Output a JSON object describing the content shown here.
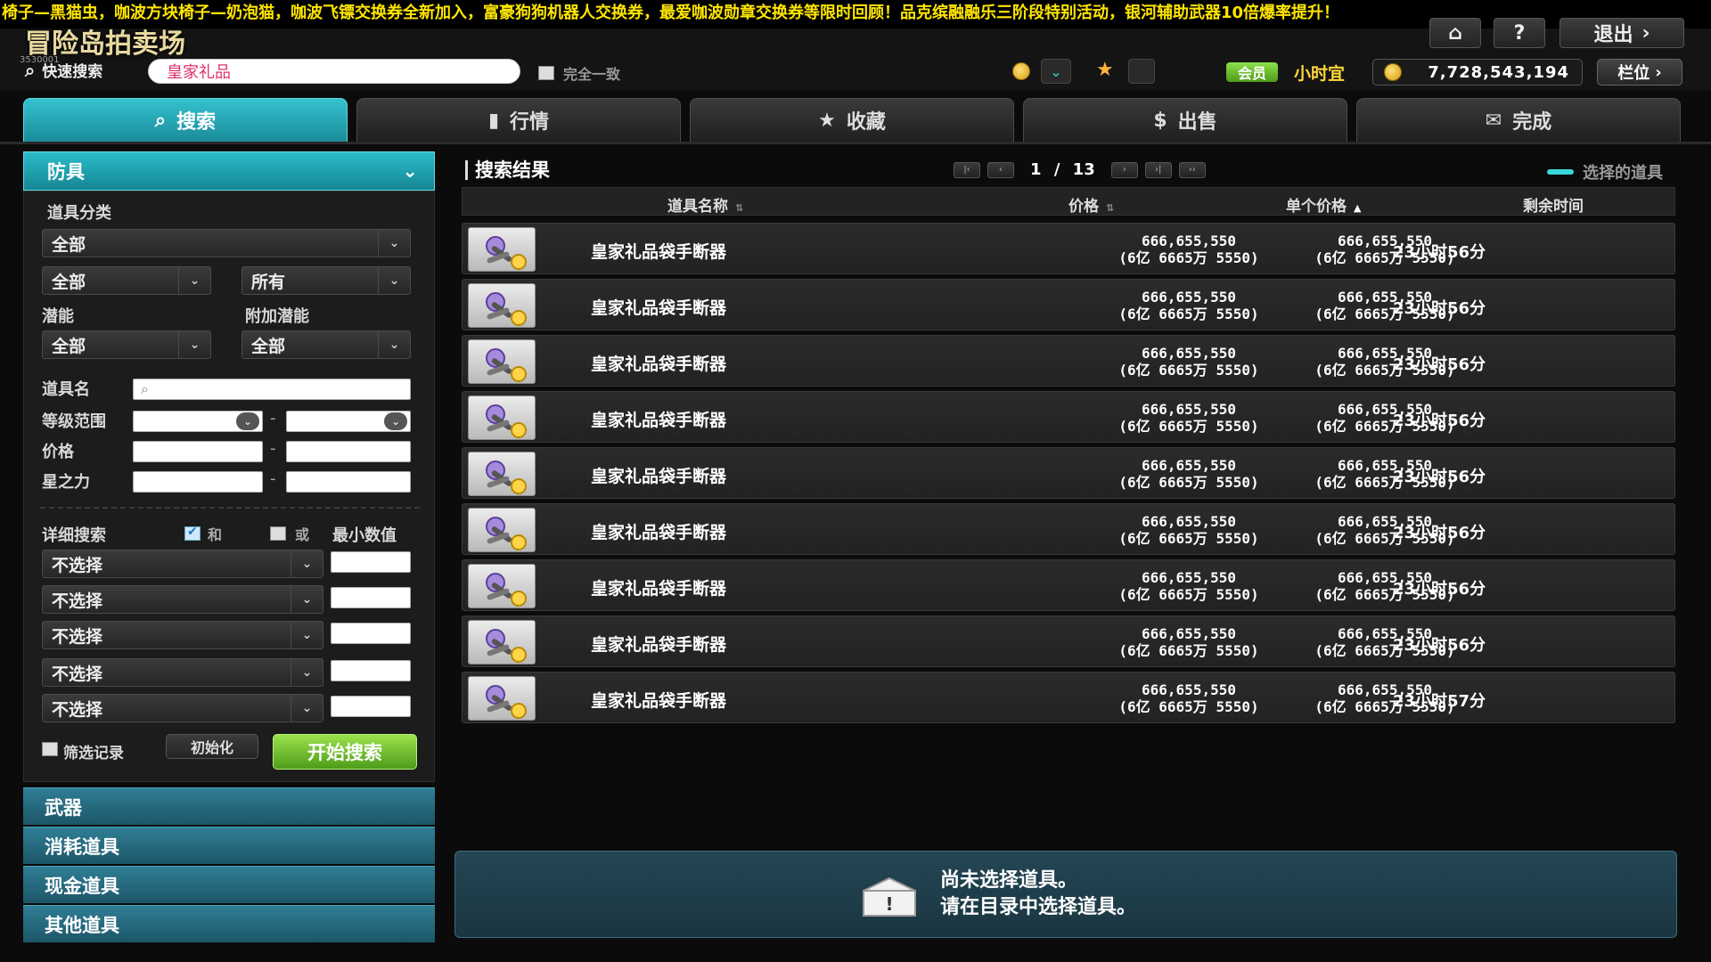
{
  "ticker": "椅子—黑猫虫，咖波方块椅子—奶泡猫，咖波飞镖交换券全新加入，富豪狗狗机器人交换券，最爱咖波勋章交换券等限时回顾！品克缤融融乐三阶段特别活动，银河辅助武器10倍爆率提升！",
  "header": {
    "title": "冒险岛拍卖场",
    "title_sub": "3530001",
    "exit_label": "退出",
    "help_label": "?",
    "quick_search_label": "快速搜索",
    "quick_search_value": "皇家礼品",
    "exact_match_label": "完全一致",
    "member_label": "会员",
    "nickname": "小时宜",
    "money": "7,728,543,194",
    "slot_label": "栏位"
  },
  "tabs": [
    {
      "label": "搜索",
      "icon": "search-icon"
    },
    {
      "label": "行情",
      "icon": "chart-icon"
    },
    {
      "label": "收藏",
      "icon": "star-icon"
    },
    {
      "label": "出售",
      "icon": "sell-icon"
    },
    {
      "label": "完成",
      "icon": "mail-icon"
    }
  ],
  "filter": {
    "category": "防具",
    "item_category_label": "道具分类",
    "sel_all": "全部",
    "sel_all2": "全部",
    "sel_any": "所有",
    "potential_label": "潜能",
    "bonus_potential_label": "附加潜能",
    "potential_value": "全部",
    "bonus_potential_value": "全部",
    "item_name_label": "道具名",
    "level_label": "等级范围",
    "price_label": "价格",
    "starforce_label": "星之力",
    "range_sep": "-",
    "detail_label": "详细搜索",
    "and_label": "和",
    "or_label": "或",
    "min_value_label": "最小数值",
    "detail_options": [
      "不选择",
      "不选择",
      "不选择",
      "不选择",
      "不选择"
    ],
    "filter_record_label": "筛选记录",
    "reset_label": "初始化",
    "search_button": "开始搜索"
  },
  "categories": [
    "武器",
    "消耗道具",
    "现金道具",
    "其他道具"
  ],
  "results": {
    "title": "搜索结果",
    "page_current": "1",
    "page_sep": "/",
    "page_total": "13",
    "selected_legend": "选择的道具",
    "columns": [
      "道具名称",
      "价格",
      "单个价格",
      "剩余时间"
    ],
    "rows": [
      {
        "name": "皇家礼品袋手断器",
        "price": "666,655,550",
        "price_cn": "(6亿 6665万 5550)",
        "unit": "666,655,550",
        "unit_cn": "(6亿 6665万 5550)",
        "time": "23小时56分"
      },
      {
        "name": "皇家礼品袋手断器",
        "price": "666,655,550",
        "price_cn": "(6亿 6665万 5550)",
        "unit": "666,655,550",
        "unit_cn": "(6亿 6665万 5550)",
        "time": "23小时56分"
      },
      {
        "name": "皇家礼品袋手断器",
        "price": "666,655,550",
        "price_cn": "(6亿 6665万 5550)",
        "unit": "666,655,550",
        "unit_cn": "(6亿 6665万 5550)",
        "time": "23小时56分"
      },
      {
        "name": "皇家礼品袋手断器",
        "price": "666,655,550",
        "price_cn": "(6亿 6665万 5550)",
        "unit": "666,655,550",
        "unit_cn": "(6亿 6665万 5550)",
        "time": "23小时56分"
      },
      {
        "name": "皇家礼品袋手断器",
        "price": "666,655,550",
        "price_cn": "(6亿 6665万 5550)",
        "unit": "666,655,550",
        "unit_cn": "(6亿 6665万 5550)",
        "time": "23小时56分"
      },
      {
        "name": "皇家礼品袋手断器",
        "price": "666,655,550",
        "price_cn": "(6亿 6665万 5550)",
        "unit": "666,655,550",
        "unit_cn": "(6亿 6665万 5550)",
        "time": "23小时56分"
      },
      {
        "name": "皇家礼品袋手断器",
        "price": "666,655,550",
        "price_cn": "(6亿 6665万 5550)",
        "unit": "666,655,550",
        "unit_cn": "(6亿 6665万 5550)",
        "time": "23小时56分"
      },
      {
        "name": "皇家礼品袋手断器",
        "price": "666,655,550",
        "price_cn": "(6亿 6665万 5550)",
        "unit": "666,655,550",
        "unit_cn": "(6亿 6665万 5550)",
        "time": "23小时56分"
      },
      {
        "name": "皇家礼品袋手断器",
        "price": "666,655,550",
        "price_cn": "(6亿 6665万 5550)",
        "unit": "666,655,550",
        "unit_cn": "(6亿 6665万 5550)",
        "time": "23小时57分"
      }
    ],
    "empty_line1": "尚未选择道具。",
    "empty_line2": "请在目录中选择道具。"
  },
  "colors": {
    "accent": "#2bbbc9",
    "go": "#7cc63a",
    "gold": "#ffd83a",
    "ticker": "#ffe600"
  }
}
